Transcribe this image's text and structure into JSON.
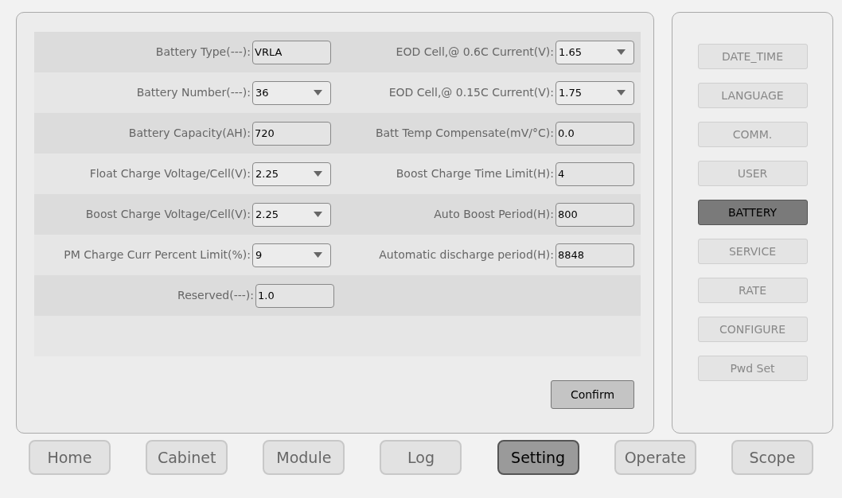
{
  "form": {
    "rows": [
      {
        "left": {
          "label": "Battery Type(---):",
          "value": "VRLA",
          "kind": "text"
        },
        "right": {
          "label": "EOD Cell,@ 0.6C Current(V):",
          "value": "1.65",
          "kind": "select"
        }
      },
      {
        "left": {
          "label": "Battery Number(---):",
          "value": "36",
          "kind": "select"
        },
        "right": {
          "label": "EOD Cell,@ 0.15C Current(V):",
          "value": "1.75",
          "kind": "select"
        }
      },
      {
        "left": {
          "label": "Battery Capacity(AH):",
          "value": "720",
          "kind": "text"
        },
        "right": {
          "label": "Batt Temp Compensate(mV/°C):",
          "value": "0.0",
          "kind": "text"
        }
      },
      {
        "left": {
          "label": "Float Charge Voltage/Cell(V):",
          "value": "2.25",
          "kind": "select"
        },
        "right": {
          "label": "Boost Charge Time Limit(H):",
          "value": "4",
          "kind": "text"
        }
      },
      {
        "left": {
          "label": "Boost Charge Voltage/Cell(V):",
          "value": "2.25",
          "kind": "select"
        },
        "right": {
          "label": "Auto Boost Period(H):",
          "value": "800",
          "kind": "text"
        }
      },
      {
        "left": {
          "label": "PM Charge Curr Percent Limit(%):",
          "value": "9",
          "kind": "select"
        },
        "right": {
          "label": "Automatic discharge period(H):",
          "value": "8848",
          "kind": "text"
        }
      },
      {
        "left": {
          "label": "Reserved(---):",
          "value": "1.0",
          "kind": "text"
        }
      }
    ],
    "confirm": "Confirm"
  },
  "side_menu": [
    {
      "label": "DATE_TIME",
      "selected": false
    },
    {
      "label": "LANGUAGE",
      "selected": false
    },
    {
      "label": "COMM.",
      "selected": false
    },
    {
      "label": "USER",
      "selected": false
    },
    {
      "label": "BATTERY",
      "selected": true
    },
    {
      "label": "SERVICE",
      "selected": false
    },
    {
      "label": "RATE",
      "selected": false
    },
    {
      "label": "CONFIGURE",
      "selected": false
    },
    {
      "label": "Pwd Set",
      "selected": false
    }
  ],
  "nav": [
    {
      "label": "Home",
      "selected": false
    },
    {
      "label": "Cabinet",
      "selected": false
    },
    {
      "label": "Module",
      "selected": false
    },
    {
      "label": "Log",
      "selected": false
    },
    {
      "label": "Setting",
      "selected": true
    },
    {
      "label": "Operate",
      "selected": false
    },
    {
      "label": "Scope",
      "selected": false
    }
  ]
}
